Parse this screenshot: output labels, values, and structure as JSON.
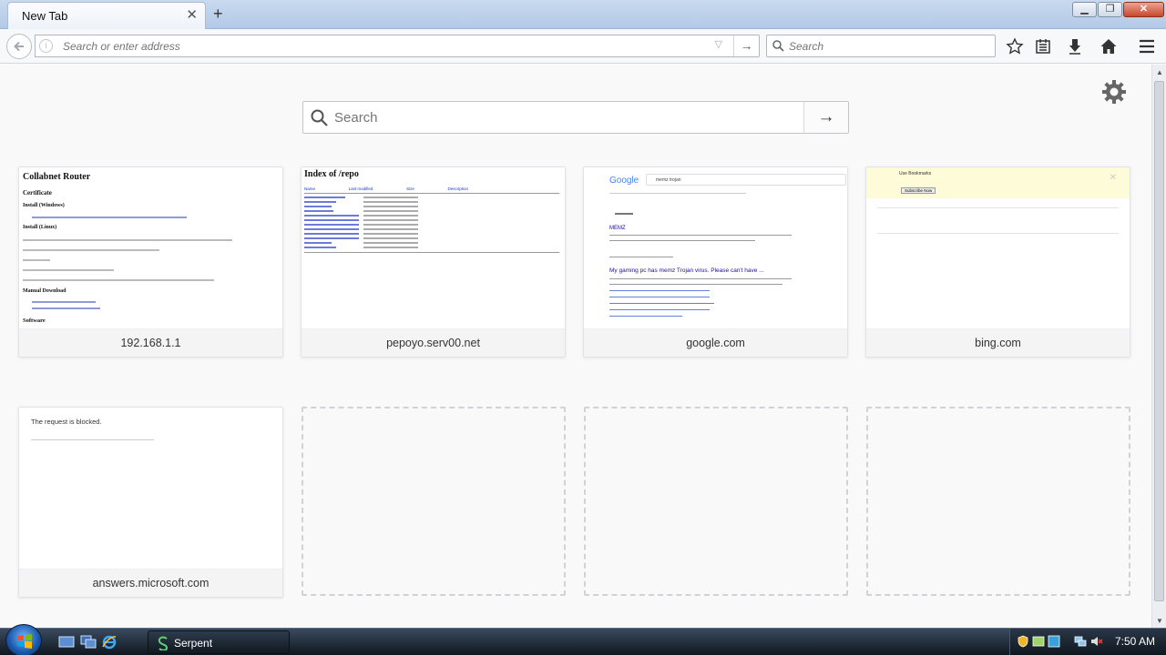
{
  "browser": {
    "tab": {
      "title": "New Tab",
      "close_glyph": "✕"
    },
    "new_tab_glyph": "+",
    "window_controls": {
      "minimize": "▁",
      "restore": "❐",
      "close": "✕"
    },
    "url_placeholder": "Search or enter address",
    "search_placeholder": "Search",
    "toolbar_icons": [
      "bookmark-star-icon",
      "reading-list-icon",
      "downloads-icon",
      "home-icon",
      "menu-icon"
    ]
  },
  "newtab": {
    "search_placeholder": "Search",
    "search_go": "→",
    "tiles": [
      {
        "title": "192.168.1.1",
        "thumb": {
          "heading": "Collabnet Router",
          "lines": [
            "Certificate",
            "Install (Windows)",
            "Install (Linux)",
            "Manual Download",
            "Software"
          ]
        }
      },
      {
        "title": "pepoyo.serv00.net",
        "thumb": {
          "heading": "Index of /repo",
          "columns": [
            "Name",
            "Last modified",
            "Size",
            "Description"
          ]
        }
      },
      {
        "title": "google.com",
        "thumb": {
          "logo": "Google",
          "query": "memz trojan",
          "result_title": "MEMZ",
          "result2_title": "My gaming pc has memz Trojan virus. Please can't have ..."
        }
      },
      {
        "title": "bing.com",
        "thumb": {
          "banner": "Use Bookmarks",
          "button": "Subscribe Now"
        }
      },
      {
        "title": "answers.microsoft.com",
        "thumb": {
          "text": "The request is blocked."
        }
      }
    ]
  },
  "taskbar": {
    "task_label": "Serpent",
    "clock": "7:50 AM"
  }
}
